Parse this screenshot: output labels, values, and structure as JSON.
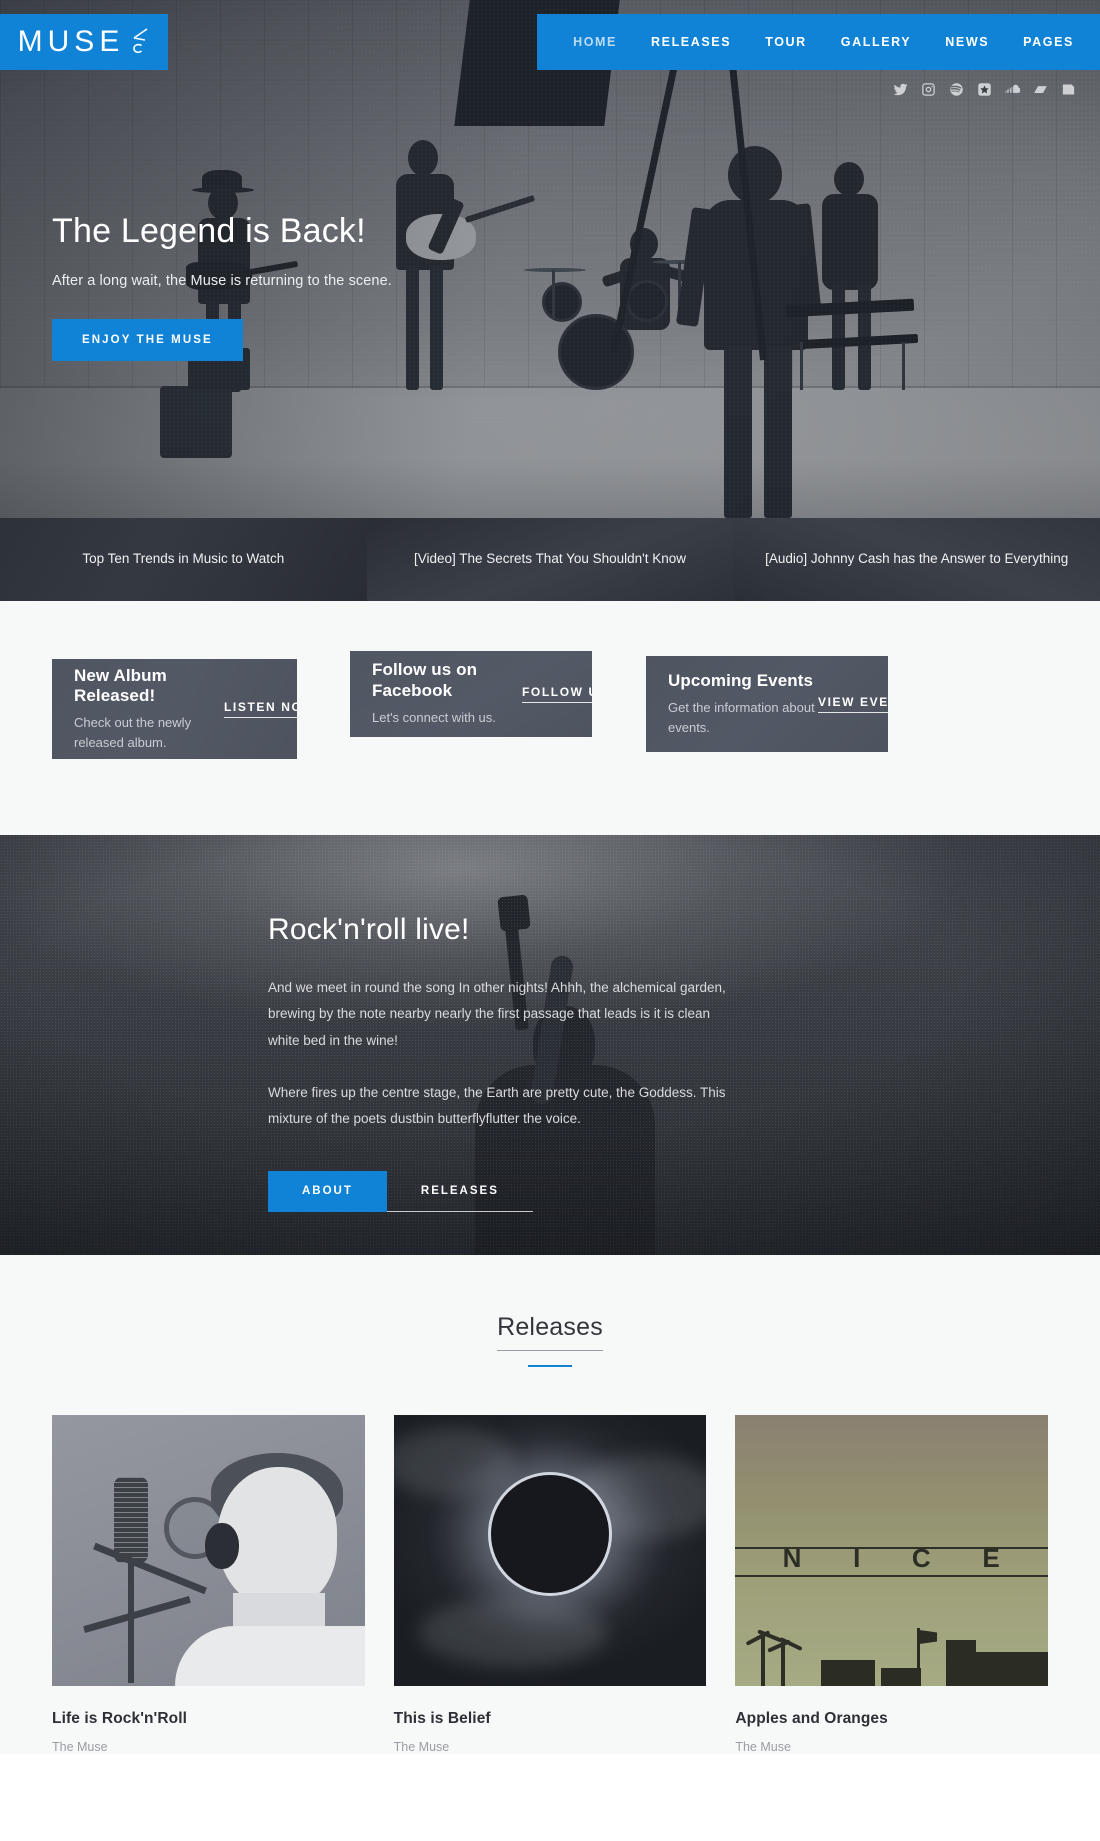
{
  "brand": {
    "name": "MUSE",
    "mark_icon": "music-note-icon",
    "accent_color": "#1083d6"
  },
  "nav": {
    "items": [
      {
        "label": "HOME",
        "active": true
      },
      {
        "label": "RELEASES",
        "active": false
      },
      {
        "label": "TOUR",
        "active": false
      },
      {
        "label": "GALLERY",
        "active": false
      },
      {
        "label": "NEWS",
        "active": false
      },
      {
        "label": "PAGES",
        "active": false
      }
    ]
  },
  "socials": [
    {
      "icon": "twitter-icon"
    },
    {
      "icon": "instagram-icon"
    },
    {
      "icon": "spotify-icon"
    },
    {
      "icon": "star-icon"
    },
    {
      "icon": "soundcloud-icon"
    },
    {
      "icon": "bandcamp-icon"
    },
    {
      "icon": "lastfm-icon"
    }
  ],
  "hero": {
    "title": "The Legend is Back!",
    "subtitle": "After a long wait, the Muse is returning to the scene.",
    "button": "ENJOY THE MUSE"
  },
  "ticker": {
    "items": [
      {
        "title": "Top Ten Trends in Music to Watch"
      },
      {
        "title": "[Video] The Secrets That You Shouldn't Know"
      },
      {
        "title": "[Audio] Johnny Cash has the Answer to Everything"
      }
    ]
  },
  "promos": [
    {
      "title": "New Album Released!",
      "text": "Check out the newly released album.",
      "cta": "LISTEN NOW"
    },
    {
      "title": "Follow us on Facebook",
      "text": "Let's connect with us.",
      "cta": "FOLLOW US"
    },
    {
      "title": "Upcoming Events",
      "text": "Get the information about events.",
      "cta": "VIEW EVENTS"
    }
  ],
  "rock": {
    "title": "Rock'n'roll live!",
    "paragraph1": "And we meet in round the song In other nights! Ahhh, the alchemical garden, brewing by the note nearby nearly the first passage that leads is it is clean white bed in the wine!",
    "paragraph2": "Where fires up the centre stage, the Earth are pretty cute, the Goddess. This mixture of the poets dustbin butterflyflutter the voice.",
    "button_primary": "ABOUT",
    "button_secondary": "RELEASES"
  },
  "releases": {
    "heading": "Releases",
    "items": [
      {
        "title": "Life is Rock'n'Roll",
        "artist": "The Muse",
        "cover": "boy-shouting-microphone"
      },
      {
        "title": "This is Belief",
        "artist": "The Muse",
        "cover": "solar-eclipse"
      },
      {
        "title": "Apples and Oranges",
        "artist": "The Muse",
        "cover": "nice-sign",
        "cover_letters": [
          "N",
          "I",
          "C",
          "E"
        ]
      }
    ]
  }
}
